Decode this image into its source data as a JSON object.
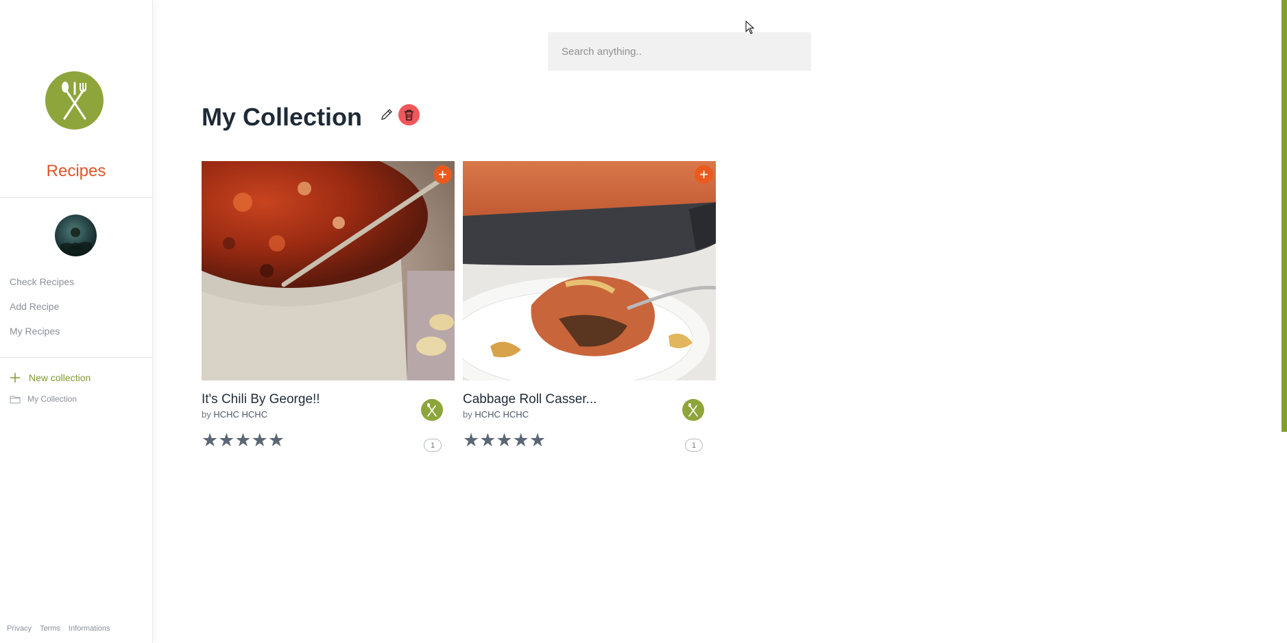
{
  "sidebar": {
    "brand": "Recipes",
    "nav": [
      {
        "label": "Check Recipes"
      },
      {
        "label": "Add Recipe"
      },
      {
        "label": "My Recipes"
      }
    ],
    "new_collection": "New collection",
    "collections": [
      {
        "label": "My Collection"
      }
    ],
    "footer": [
      "Privacy",
      "Terms",
      "Informations"
    ]
  },
  "search": {
    "placeholder": "Search anything.."
  },
  "page": {
    "title": "My Collection"
  },
  "cards": [
    {
      "title": "It's Chili By George!!",
      "by": "by",
      "author": "HCHC HCHC",
      "stars": "★★★★★",
      "count": "1"
    },
    {
      "title": "Cabbage Roll Casser...",
      "by": "by",
      "author": "HCHC HCHC",
      "stars": "★★★★★",
      "count": "1"
    }
  ],
  "colors": {
    "brand_orange": "#e0552a",
    "accent_green": "#8ea53b",
    "delete_red": "#f0575b",
    "add_orange": "#ea5a1f"
  },
  "icons": [
    "fork-knife-icon",
    "pencil-icon",
    "trash-icon",
    "plus-icon",
    "folder-icon"
  ]
}
